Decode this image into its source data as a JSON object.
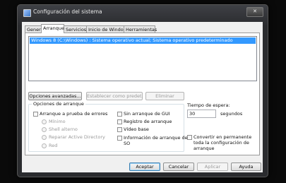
{
  "window": {
    "title": "Configuración del sistema",
    "close_glyph": "✕"
  },
  "tabs": [
    {
      "label": "General"
    },
    {
      "label": "Arranque"
    },
    {
      "label": "Servicios"
    },
    {
      "label": "Inicio de Windows"
    },
    {
      "label": "Herramientas"
    }
  ],
  "boot_list": {
    "selected_entry": "Windows 8 (C:\\Windows) : Sistema operativo actual; Sistema operativo predeterminado"
  },
  "boot_buttons": {
    "advanced": "Opciones avanzadas...",
    "set_default": "Establecer como predet.",
    "delete": "Eliminar"
  },
  "boot_options": {
    "legend": "Opciones de arranque",
    "safe_boot": "Arranque a prueba de errores",
    "minimal": "Mínimo",
    "alternate_shell": "Shell alterno",
    "active_directory": "Reparar Active Directory",
    "network": "Red",
    "no_gui": "Sin arranque de GUI",
    "boot_log": "Registro de arranque",
    "base_video": "Vídeo base",
    "os_boot_info_1": "Información de arranque del",
    "os_boot_info_2": "SO"
  },
  "timeout": {
    "label": "Tiempo de espera:",
    "value": "30",
    "unit": "segundos"
  },
  "permanent": {
    "line1": "Convertir en permanente",
    "line2": "toda la configuración de",
    "line3": "arranque"
  },
  "footer": {
    "ok": "Aceptar",
    "cancel": "Cancelar",
    "apply": "Aplicar",
    "help": "Ayuda"
  },
  "colors": {
    "selection": "#3399ff",
    "title_bg": "#2a2b2e"
  }
}
